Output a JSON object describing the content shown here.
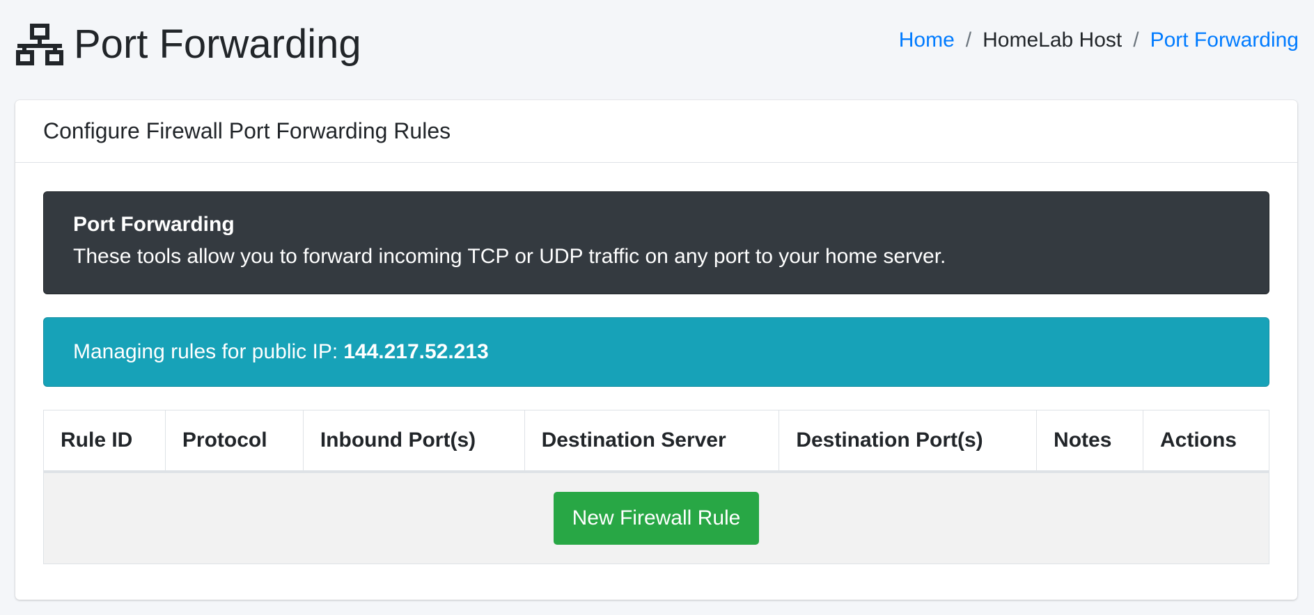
{
  "header": {
    "icon": "network-icon",
    "title": "Port Forwarding"
  },
  "breadcrumb": {
    "home": "Home",
    "host": "HomeLab Host",
    "current": "Port Forwarding"
  },
  "card": {
    "title": "Configure Firewall Port Forwarding Rules"
  },
  "callout": {
    "title": "Port Forwarding",
    "text": "These tools allow you to forward incoming TCP or UDP traffic on any port to your home server."
  },
  "alert": {
    "prefix": "Managing rules for public IP:",
    "ip": "144.217.52.213"
  },
  "table": {
    "columns": [
      "Rule ID",
      "Protocol",
      "Inbound Port(s)",
      "Destination Server",
      "Destination Port(s)",
      "Notes",
      "Actions"
    ],
    "new_rule_label": "New Firewall Rule"
  },
  "colors": {
    "link": "#007bff",
    "callout_bg": "#343a40",
    "info_bg": "#17a2b8",
    "success": "#28a745",
    "page_bg": "#f4f6f9"
  }
}
